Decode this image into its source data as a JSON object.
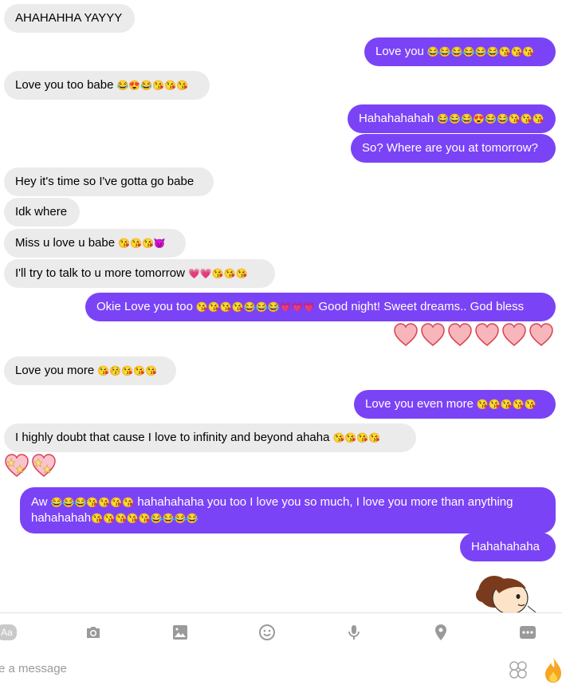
{
  "messages": [
    {
      "id": "m1",
      "side": "in",
      "text": "AHAHAHHA YAYYY",
      "emoji": ""
    },
    {
      "id": "m2",
      "side": "out",
      "text": "Love you",
      "emoji": "😂😂😂😂😂😂😘😘😘"
    },
    {
      "id": "m3",
      "side": "in",
      "text": "Love you too babe",
      "emoji": "😂😍😂😘😘😘"
    },
    {
      "id": "m4",
      "side": "out",
      "text": "Hahahahahah",
      "emoji": "😂😂😂😍😂😂😘😘😘"
    },
    {
      "id": "m5",
      "side": "out",
      "text": "So? Where are you at tomorrow?",
      "emoji": ""
    },
    {
      "id": "m6",
      "side": "in",
      "text": "Hey it's time so I've gotta go babe",
      "emoji": ""
    },
    {
      "id": "m7",
      "side": "in",
      "text": "Idk where",
      "emoji": ""
    },
    {
      "id": "m8",
      "side": "in",
      "text": "Miss u love u babe",
      "emoji": "😘😘😘😈"
    },
    {
      "id": "m9",
      "side": "in",
      "text": "I'll try to talk to u more tomorrow",
      "emoji": "💗💗😘😘😘"
    },
    {
      "id": "m10",
      "side": "out",
      "text": "Okie Love you too",
      "emoji": "😘😘😘😘😂😂😂💗💗💗",
      "text2": "Good night! Sweet dreams.. God bless"
    },
    {
      "id": "m11",
      "side": "in",
      "text": "Love you more",
      "emoji": "😘😚😘😘😘"
    },
    {
      "id": "m12",
      "side": "out",
      "text": "Love you even more",
      "emoji": "😘😘😘😘😘"
    },
    {
      "id": "m13",
      "side": "in",
      "text": "I highly doubt that cause I love to infinity and beyond ahaha",
      "emoji": "😘😘😘😘"
    },
    {
      "id": "m14",
      "side": "out",
      "text": "Aw",
      "emoji1": "😂😂😂😘😘😘😘",
      "text2": "hahahahaha you too I love you so much, I love you more than anything",
      "text3": "hahahahah",
      "emoji2": "😘😘😘😘😘😂😂😂😂"
    },
    {
      "id": "m15",
      "side": "out",
      "text": "Hahahahaha",
      "emoji": ""
    }
  ],
  "composer": {
    "aa_label": "Aa",
    "placeholder": "e a message"
  },
  "colors": {
    "outgoing": "#7b43f6",
    "incoming": "#ebebeb",
    "icon": "#9a9a9a"
  },
  "icons": [
    "text-format-icon",
    "camera-icon",
    "image-icon",
    "emoji-icon",
    "microphone-icon",
    "location-icon",
    "more-icon",
    "sticker-icon",
    "like-flame-icon"
  ]
}
